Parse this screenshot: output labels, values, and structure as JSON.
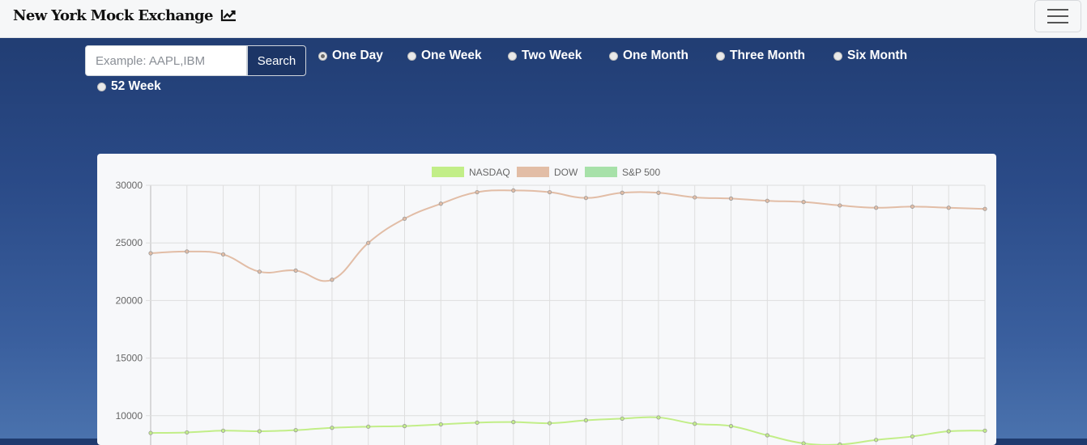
{
  "navbar": {
    "brand": "New York Mock Exchange",
    "brand_icon": "chart-line-icon",
    "menu_icon": "hamburger-menu-icon"
  },
  "search": {
    "placeholder": "Example: AAPL,IBM",
    "value": "",
    "button_label": "Search"
  },
  "ranges": [
    {
      "label": "One Day",
      "checked": true
    },
    {
      "label": "One Week",
      "checked": false
    },
    {
      "label": "Two Week",
      "checked": false
    },
    {
      "label": "One Month",
      "checked": false
    },
    {
      "label": "Three Month",
      "checked": false
    },
    {
      "label": "Six Month",
      "checked": false
    },
    {
      "label": "52 Week",
      "checked": false
    }
  ],
  "chart_data": {
    "type": "line",
    "legend_position": "top-center",
    "grid": true,
    "ylim": [
      0,
      30000
    ],
    "yticks": [
      "30000",
      "25000",
      "20000",
      "15000",
      "10000"
    ],
    "series": [
      {
        "name": "NASDAQ",
        "color": "#c2ee88",
        "values": [
          8500,
          8550,
          8700,
          8650,
          8750,
          8950,
          9050,
          9100,
          9250,
          9400,
          9450,
          9350,
          9600,
          9750,
          9850,
          9300,
          9100,
          8300,
          7600,
          7500,
          7900,
          8200,
          8650,
          8700
        ]
      },
      {
        "name": "DOW",
        "color": "#e2bda6",
        "values": [
          24100,
          24250,
          24000,
          22500,
          22600,
          21800,
          25000,
          27100,
          28400,
          29400,
          29550,
          29400,
          28900,
          29350,
          29350,
          28950,
          28850,
          28650,
          28550,
          28250,
          28050,
          28150,
          28050,
          27950
        ]
      },
      {
        "name": "S&P 500",
        "color": "#a7e1a9",
        "values": []
      }
    ]
  }
}
